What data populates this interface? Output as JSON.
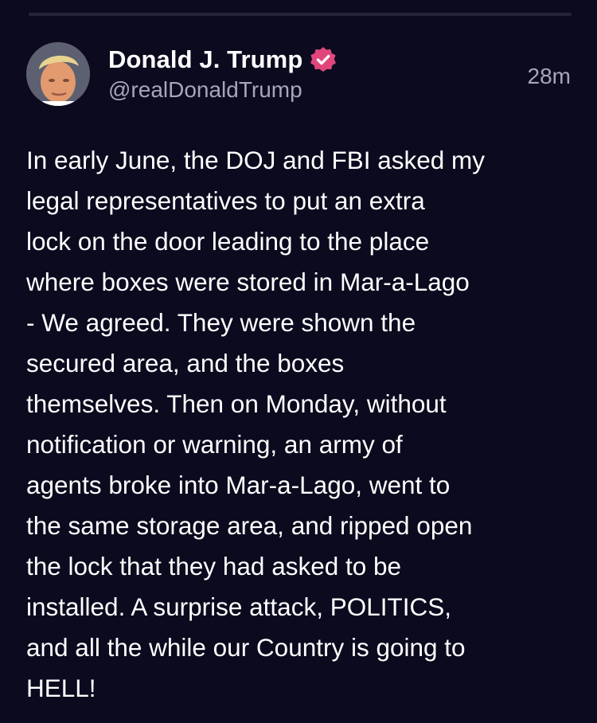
{
  "post": {
    "author_name": "Donald J. Trump",
    "handle": "@realDonaldTrump",
    "timestamp": "28m",
    "verified_icon": "verified-badge-icon",
    "body": "In early June, the DOJ and FBI asked my\nlegal representatives to put an extra\nlock on the door leading to the place\nwhere boxes were stored in Mar-a-Lago\n- We agreed. They were shown the\nsecured area, and the boxes\nthemselves. Then on Monday, without\nnotification or warning, an army of\nagents broke into Mar-a-Lago, went to\nthe same storage area, and ripped open\nthe lock that they had asked to be\ninstalled. A surprise attack, POLITICS,\nand all the while our Country is going to\nHELL!"
  },
  "colors": {
    "background": "#0b0a1e",
    "secondary_text": "#a7a5ba",
    "verified_badge": "#e0467c"
  }
}
